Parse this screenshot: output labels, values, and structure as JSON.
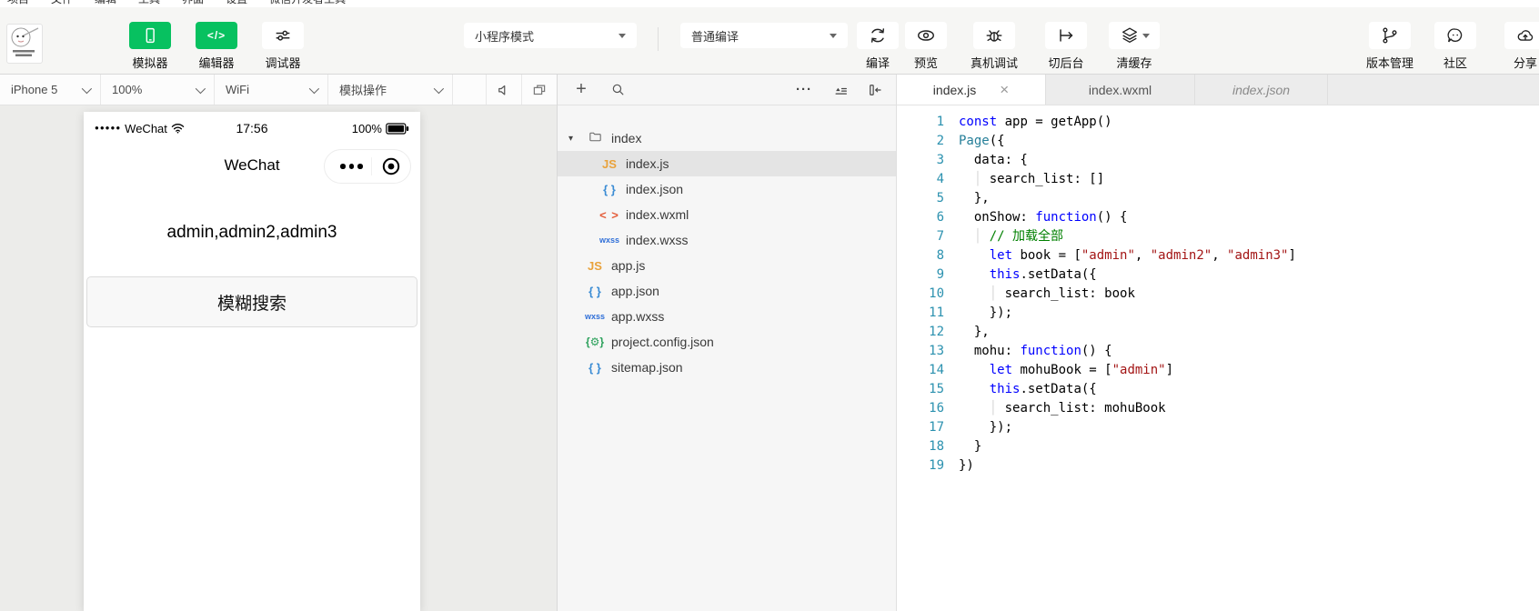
{
  "menubar": {
    "items": [
      "项目",
      "文件",
      "编辑",
      "工具",
      "界面",
      "设置",
      "微信开发者工具"
    ]
  },
  "icons": {
    "plus": "+",
    "more": "···",
    "close": "×",
    "folder_arrow": "▾",
    "code_glyph": "</>"
  },
  "toolbar": {
    "accent_green": "#07c160",
    "mode_buttons": [
      {
        "label": "模拟器",
        "icon": "phone-icon",
        "active": true
      },
      {
        "label": "编辑器",
        "icon": "code-icon",
        "active": true
      },
      {
        "label": "调试器",
        "icon": "sliders-icon",
        "active": false
      }
    ],
    "mode_select": {
      "value": "小程序模式"
    },
    "compile_select": {
      "value": "普通编译"
    },
    "actions": [
      {
        "label": "编译",
        "icon": "refresh-icon"
      },
      {
        "label": "预览",
        "icon": "eye-icon"
      },
      {
        "label": "真机调试",
        "icon": "bug-icon"
      },
      {
        "label": "切后台",
        "icon": "switch-background-icon"
      },
      {
        "label": "清缓存",
        "icon": "layers-icon"
      }
    ],
    "right_actions": [
      {
        "label": "版本管理",
        "icon": "git-branch-icon"
      },
      {
        "label": "社区",
        "icon": "chat-bubble-icon"
      },
      {
        "label": "分享",
        "icon": "cloud-share-icon"
      }
    ]
  },
  "simulator": {
    "controls": [
      {
        "id": "device",
        "value": "iPhone 5"
      },
      {
        "id": "zoom",
        "value": "100%"
      },
      {
        "id": "network",
        "value": "WiFi"
      },
      {
        "id": "simulate",
        "value": "模拟操作"
      }
    ],
    "phone": {
      "status_bar": {
        "signal_dots": "●●●●●",
        "carrier": "WeChat",
        "time": "17:56",
        "battery": "100%"
      },
      "nav_title": "WeChat",
      "content_text": "admin,admin2,admin3",
      "button_label": "模糊搜索"
    }
  },
  "file_panel": {
    "tree": [
      {
        "name": "index",
        "type": "folder",
        "depth": 0,
        "expanded": true
      },
      {
        "name": "index.js",
        "type": "js",
        "depth": 1,
        "selected": true
      },
      {
        "name": "index.json",
        "type": "json",
        "depth": 1
      },
      {
        "name": "index.wxml",
        "type": "wxml",
        "depth": 1
      },
      {
        "name": "index.wxss",
        "type": "wxss",
        "depth": 1
      },
      {
        "name": "app.js",
        "type": "js",
        "depth": 0
      },
      {
        "name": "app.json",
        "type": "json",
        "depth": 0
      },
      {
        "name": "app.wxss",
        "type": "wxss",
        "depth": 0
      },
      {
        "name": "project.config.json",
        "type": "config",
        "depth": 0
      },
      {
        "name": "sitemap.json",
        "type": "json",
        "depth": 0
      }
    ]
  },
  "editor": {
    "tabs": [
      {
        "label": "index.js",
        "active": true,
        "closable": true
      },
      {
        "label": "index.wxml",
        "active": false
      },
      {
        "label": "index.json",
        "active": false,
        "preview": true
      }
    ],
    "code": {
      "language": "javascript",
      "lines": [
        [
          {
            "s": "const",
            "c": "kw"
          },
          {
            "s": " app = getApp()",
            "c": "pl"
          }
        ],
        [
          {
            "s": "Page",
            "c": "ty"
          },
          {
            "s": "({",
            "c": "pl"
          }
        ],
        [
          {
            "s": "  data: {",
            "c": "pl"
          }
        ],
        [
          {
            "s": "  ",
            "c": "pl"
          },
          {
            "s": "│",
            "c": "gd"
          },
          {
            "s": " search_list: []",
            "c": "pl"
          }
        ],
        [
          {
            "s": "  },",
            "c": "pl"
          }
        ],
        [
          {
            "s": "  onShow: ",
            "c": "pl"
          },
          {
            "s": "function",
            "c": "kw"
          },
          {
            "s": "() {",
            "c": "pl"
          }
        ],
        [
          {
            "s": "  ",
            "c": "pl"
          },
          {
            "s": "│",
            "c": "gd"
          },
          {
            "s": " ",
            "c": "pl"
          },
          {
            "s": "// 加载全部",
            "c": "cm"
          }
        ],
        [
          {
            "s": "    ",
            "c": "pl"
          },
          {
            "s": "let",
            "c": "kw"
          },
          {
            "s": " book = [",
            "c": "pl"
          },
          {
            "s": "\"admin\"",
            "c": "st"
          },
          {
            "s": ", ",
            "c": "pl"
          },
          {
            "s": "\"admin2\"",
            "c": "st"
          },
          {
            "s": ", ",
            "c": "pl"
          },
          {
            "s": "\"admin3\"",
            "c": "st"
          },
          {
            "s": "]",
            "c": "pl"
          }
        ],
        [
          {
            "s": "    ",
            "c": "pl"
          },
          {
            "s": "this",
            "c": "kw"
          },
          {
            "s": ".setData({",
            "c": "pl"
          }
        ],
        [
          {
            "s": "    ",
            "c": "pl"
          },
          {
            "s": "│",
            "c": "gd"
          },
          {
            "s": " search_list: book",
            "c": "pl"
          }
        ],
        [
          {
            "s": "    });",
            "c": "pl"
          }
        ],
        [
          {
            "s": "  },",
            "c": "pl"
          }
        ],
        [
          {
            "s": "  mohu: ",
            "c": "pl"
          },
          {
            "s": "function",
            "c": "kw"
          },
          {
            "s": "() {",
            "c": "pl"
          }
        ],
        [
          {
            "s": "    ",
            "c": "pl"
          },
          {
            "s": "let",
            "c": "kw"
          },
          {
            "s": " mohuBook = [",
            "c": "pl"
          },
          {
            "s": "\"admin\"",
            "c": "st"
          },
          {
            "s": "]",
            "c": "pl"
          }
        ],
        [
          {
            "s": "    ",
            "c": "pl"
          },
          {
            "s": "this",
            "c": "kw"
          },
          {
            "s": ".setData({",
            "c": "pl"
          }
        ],
        [
          {
            "s": "    ",
            "c": "pl"
          },
          {
            "s": "│",
            "c": "gd"
          },
          {
            "s": " search_list: mohuBook",
            "c": "pl"
          }
        ],
        [
          {
            "s": "    });",
            "c": "pl"
          }
        ],
        [
          {
            "s": "  }",
            "c": "pl"
          }
        ],
        [
          {
            "s": "})",
            "c": "pl"
          }
        ]
      ]
    }
  }
}
